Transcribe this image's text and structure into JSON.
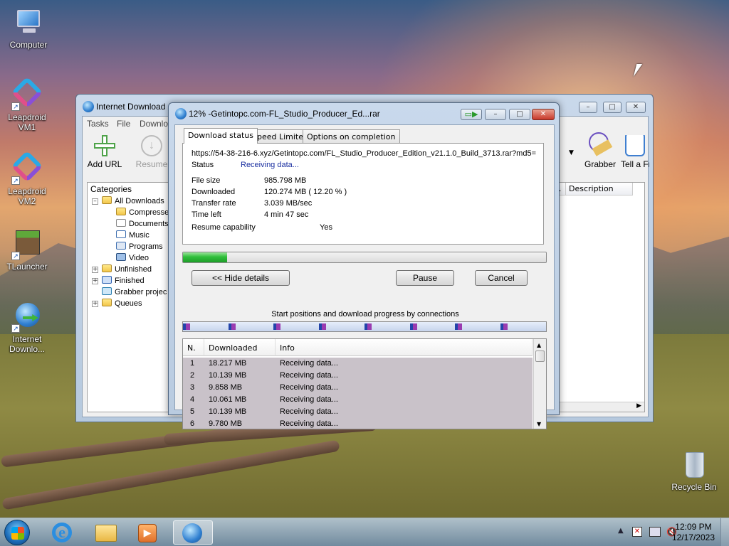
{
  "desktop": {
    "icons": [
      {
        "label": "Computer",
        "icon": "computer-icon"
      },
      {
        "label": "Leapdroid VM1",
        "icon": "leapdroid-icon"
      },
      {
        "label": "Leapdroid VM2",
        "icon": "leapdroid-icon"
      },
      {
        "label": "TLauncher",
        "icon": "minecraft-block-icon"
      },
      {
        "label": "Internet Downlo...",
        "icon": "idm-globe-icon"
      },
      {
        "label": "Recycle Bin",
        "icon": "recycle-bin-icon"
      }
    ]
  },
  "idm_main": {
    "title": "Internet Download",
    "menu": [
      "Tasks",
      "File",
      "Downlo"
    ],
    "toolbar": [
      {
        "label": "Add URL",
        "icon": "plus-icon"
      },
      {
        "label": "Resume",
        "icon": "resume-arrow-icon"
      },
      {
        "label": "Grabber",
        "icon": "grabber-icon"
      },
      {
        "label": "Tell a Fr",
        "icon": "thumbs-up-icon"
      }
    ],
    "categories_title": "Categories",
    "tree": [
      {
        "label": "All Downloads",
        "level": 1
      },
      {
        "label": "Compresse",
        "level": 2
      },
      {
        "label": "Documents",
        "level": 2
      },
      {
        "label": "Music",
        "level": 2
      },
      {
        "label": "Programs",
        "level": 2
      },
      {
        "label": "Video",
        "level": 2
      },
      {
        "label": "Unfinished",
        "level": 1
      },
      {
        "label": "Finished",
        "level": 1
      },
      {
        "label": "Grabber projec",
        "level": 1
      },
      {
        "label": "Queues",
        "level": 1
      }
    ],
    "list_headers": [
      "y...",
      "Description"
    ],
    "list_row_cell": "..."
  },
  "dialog": {
    "title": "12% -Getintopc.com-FL_Studio_Producer_Ed...rar",
    "tabs": [
      "Download status",
      "Speed Limiter",
      "Options on completion"
    ],
    "url": "https://54-38-216-6.xyz/Getintopc.com/FL_Studio_Producer_Edition_v21.1.0_Build_3713.rar?md5=",
    "status_label": "Status",
    "status_value": "Receiving data...",
    "file_size_label": "File size",
    "file_size_value": "985.798  MB",
    "downloaded_label": "Downloaded",
    "downloaded_value": "120.274  MB  ( 12.20 % )",
    "transfer_rate_label": "Transfer rate",
    "transfer_rate_value": "3.039  MB/sec",
    "time_left_label": "Time left",
    "time_left_value": "4 min 47 sec",
    "resume_label": "Resume capability",
    "resume_value": "Yes",
    "progress_percent": 12.2,
    "hide_details_label": "<< Hide details",
    "pause_label": "Pause",
    "cancel_label": "Cancel",
    "connections_caption": "Start positions and download progress by connections",
    "connection_marks": 8,
    "table_headers": [
      "N.",
      "Downloaded",
      "Info"
    ],
    "connections": [
      {
        "n": "1",
        "downloaded": "18.217  MB",
        "info": "Receiving data..."
      },
      {
        "n": "2",
        "downloaded": "10.139  MB",
        "info": "Receiving data..."
      },
      {
        "n": "3",
        "downloaded": "9.858  MB",
        "info": "Receiving data..."
      },
      {
        "n": "4",
        "downloaded": "10.061  MB",
        "info": "Receiving data..."
      },
      {
        "n": "5",
        "downloaded": "10.139  MB",
        "info": "Receiving data..."
      },
      {
        "n": "6",
        "downloaded": "9.780  MB",
        "info": "Receiving data..."
      }
    ]
  },
  "taskbar": {
    "time": "12:09 PM",
    "date": "12/17/2023",
    "tray_icons": [
      "show-hidden-icon",
      "action-center-flag-icon",
      "network-icon",
      "volume-muted-icon"
    ]
  },
  "colors": {
    "progress_green": "#2fbf3a",
    "status_blue": "#1a2fa0",
    "close_red": "#c8382a"
  }
}
